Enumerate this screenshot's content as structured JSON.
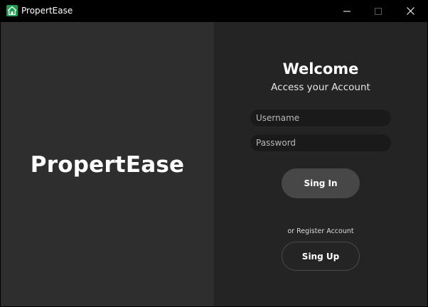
{
  "window": {
    "title": "PropertEase",
    "app_icon": "house-icon",
    "controls": {
      "minimize_icon": "minimize-icon",
      "maximize_icon": "maximize-icon",
      "close_icon": "close-icon"
    }
  },
  "left_panel": {
    "brand": "PropertEase"
  },
  "login": {
    "heading": "Welcome",
    "subheading": "Access your Account",
    "username_placeholder": "Username",
    "password_placeholder": "Password",
    "signin_label": "Sing In",
    "register_prompt": "or Register Account",
    "signup_label": "Sing Up"
  },
  "colors": {
    "accent_icon": "#1e9c4f",
    "left_panel_bg": "#2e2e2e",
    "right_panel_bg": "#242424",
    "button_bg": "#474747"
  }
}
